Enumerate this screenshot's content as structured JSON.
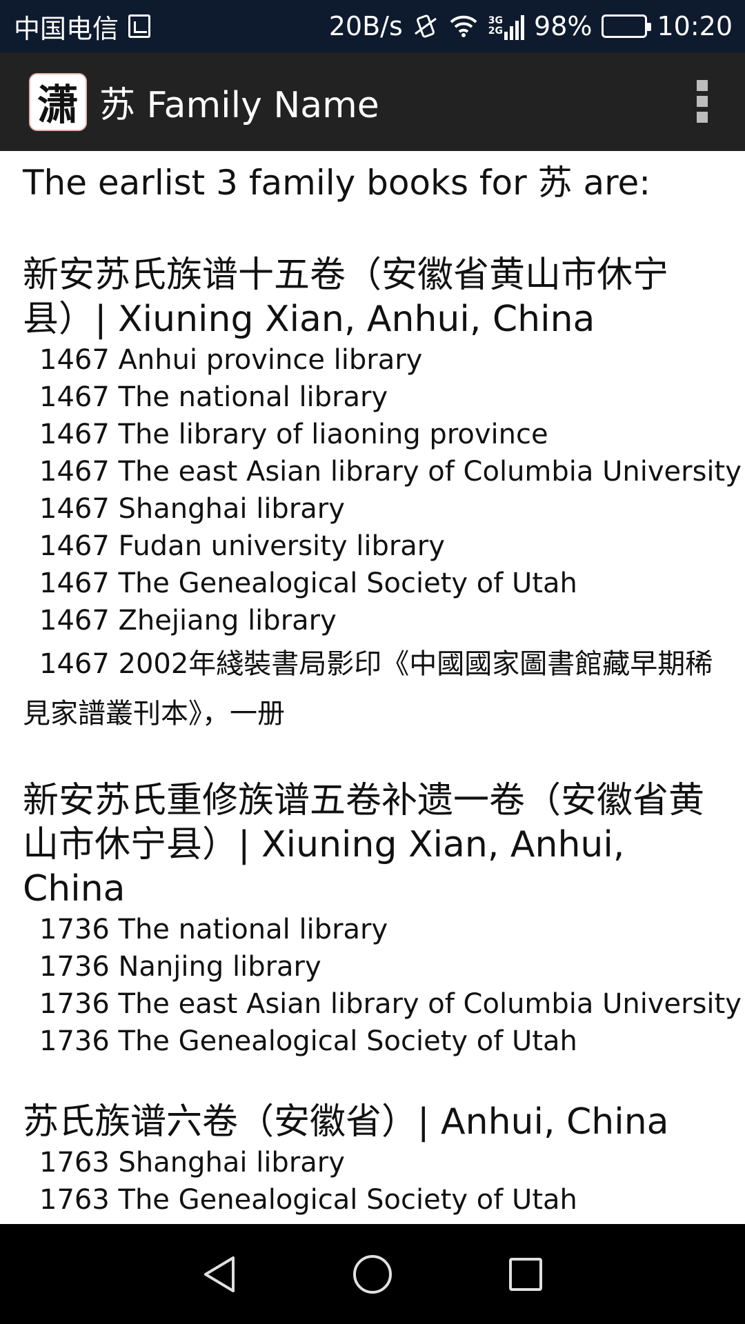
{
  "status_bar": {
    "carrier": "中国电信",
    "speed": "20B/s",
    "net_top": "3G",
    "net_bottom": "2G",
    "battery": "98%",
    "battery_level": 0.98,
    "time": "10:20"
  },
  "app_bar": {
    "icon_char": "潇",
    "title": "苏 Family Name",
    "menu_icon": "overflow-menu-icon"
  },
  "content": {
    "intro": "The earlist 3 family books for 苏 are:",
    "books": [
      {
        "title": "新安苏氏族谱十五卷（安徽省黄山市休宁县）| Xiuning Xian, Anhui, China",
        "holdings": [
          "1467 Anhui province library",
          "1467 The national library",
          "1467 The library of liaoning province",
          "1467 The east Asian library of Columbia University",
          "1467 Shanghai library",
          "1467 Fudan university library",
          "1467 The Genealogical Society of Utah",
          "1467 Zhejiang library",
          "1467 2002年綫裝書局影印《中國國家圖書館藏早期稀見家譜叢刊本》，一册"
        ]
      },
      {
        "title": "新安苏氏重修族谱五卷补遗一卷（安徽省黄山市休宁县）| Xiuning Xian, Anhui, China",
        "holdings": [
          "1736 The national library",
          "1736 Nanjing library",
          "1736 The east Asian library of Columbia University",
          "1736 The Genealogical Society of Utah"
        ]
      },
      {
        "title": "苏氏族谱六卷（安徽省）| Anhui, China",
        "holdings": [
          "1763 Shanghai library",
          "1763 The Genealogical Society of Utah"
        ]
      }
    ]
  },
  "nav_bar": {
    "back": "back-icon",
    "home": "home-icon",
    "recents": "recents-icon"
  }
}
